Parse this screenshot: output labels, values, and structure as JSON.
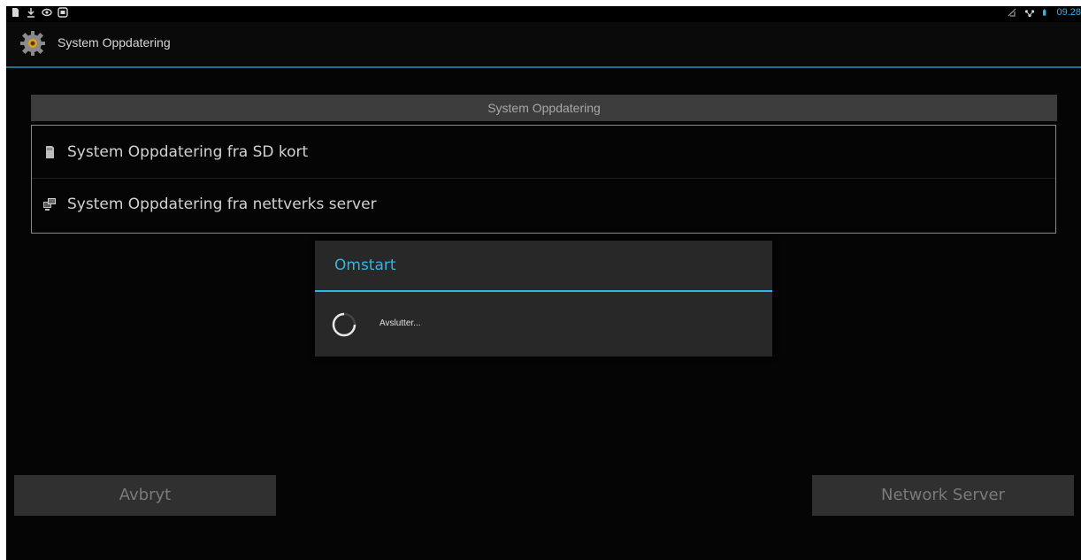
{
  "status_bar": {
    "left_icons": [
      "sd-card-icon",
      "download-icon",
      "eye-icon",
      "screen-icon"
    ],
    "right_icons": [
      "signal-off-icon",
      "network-icon",
      "battery-icon"
    ],
    "time": "09.28"
  },
  "action_bar": {
    "title": "System Oppdatering",
    "icon": "gear-icon"
  },
  "content": {
    "header": "System Oppdatering",
    "items": [
      {
        "label": "System Oppdatering fra SD kort",
        "icon": "sd-card-icon"
      },
      {
        "label": "System Oppdatering fra nettverks server",
        "icon": "network-server-icon"
      }
    ]
  },
  "dialog": {
    "title": "Omstart",
    "message": "Avslutter..."
  },
  "buttons": {
    "cancel": "Avbryt",
    "network_server": "Network Server"
  },
  "colors": {
    "accent": "#33b5e5",
    "background": "#050505",
    "dialog_bg": "#282828"
  }
}
